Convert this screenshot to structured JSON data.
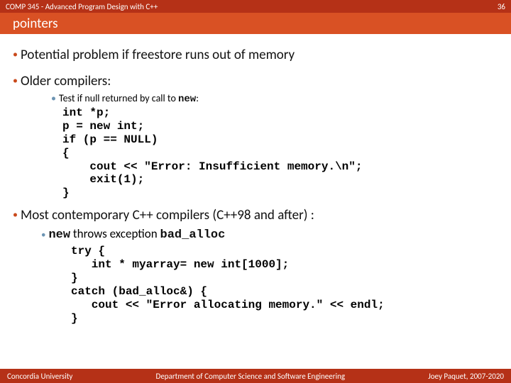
{
  "header": {
    "course": "COMP 345 - Advanced Program Design with C++",
    "slide_no": "36"
  },
  "title": "pointers",
  "b1": "Potential problem if freestore runs out of memory",
  "b2": "Older compilers:",
  "b2_sub_prefix": "Test if null returned by call to ",
  "b2_sub_kw": "new",
  "b2_sub_colon": ":",
  "code1": "int *p;\np = new int;\nif (p == NULL)\n{\n    cout << \"Error: Insufficient memory.\\n\";\n    exit(1);\n}",
  "b3": "Most contemporary C++ compilers (C++98 and after) :",
  "b3_sub_kw": "new",
  "b3_sub_mid": " throws exception ",
  "b3_sub_exc": "bad_alloc",
  "code2": "try {\n   int * myarray= new int[1000];\n}\ncatch (bad_alloc&) {\n   cout << \"Error allocating memory.\" << endl;\n}",
  "footer": {
    "left": "Concordia University",
    "center": "Department of Computer Science and Software Engineering",
    "right": "Joey Paquet, 2007-2020"
  }
}
